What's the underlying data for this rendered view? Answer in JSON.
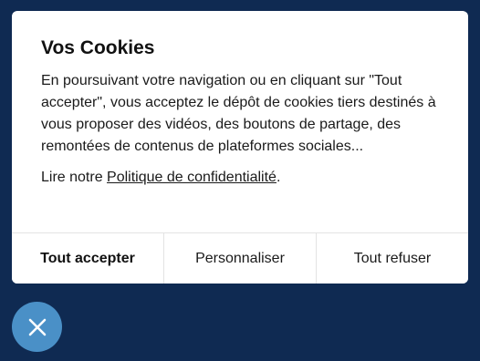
{
  "dialog": {
    "title": "Vos Cookies",
    "description": "En poursuivant votre navigation ou en cliquant sur \"Tout accepter\", vous acceptez le dépôt de cookies tiers destinés à vous proposer des vidéos, des boutons de partage, des remontées de contenus de plateformes sociales...",
    "policy_prefix": "Lire notre ",
    "policy_link": "Politique de confidentialité",
    "policy_suffix": "."
  },
  "actions": {
    "accept_all": "Tout accepter",
    "customize": "Personnaliser",
    "refuse_all": "Tout refuser"
  },
  "close_button": {
    "icon": "close-icon"
  },
  "colors": {
    "background": "#0f2a52",
    "dialog": "#ffffff",
    "close_button": "#4a90c7"
  }
}
